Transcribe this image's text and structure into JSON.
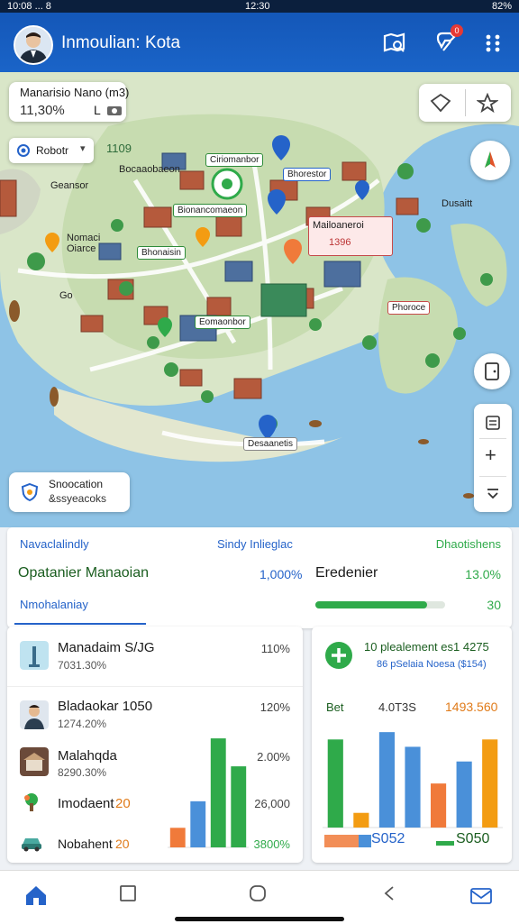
{
  "status": {
    "left": "10:08 ... 8",
    "center": "12:30",
    "right": "82%"
  },
  "app": {
    "title": "Inmoulian: Kota",
    "notification_count": "0"
  },
  "map": {
    "info_card": {
      "title": "Manarisio Nano (m3)",
      "value": "11,30%",
      "suffix": "L"
    },
    "filter": {
      "label": "Robotr"
    },
    "filter_value": "1109",
    "bottom_card": {
      "line1": "Snoocation",
      "line2": "&ssyeacoks"
    },
    "labels": [
      "Ciriomanbor",
      "Bocaaobaeon",
      "Geansor",
      "Nomaci",
      "Oiarce",
      "Go",
      "Bhorestor",
      "Bionancomaeon",
      "Bhonaisin",
      "Eomaonbor",
      "Mailoaneroi",
      "1396",
      "Dusaitt",
      "Phoroce",
      "Desaanetis",
      "Go"
    ]
  },
  "panel": {
    "header_left": "Navaclalindly",
    "header_center": "Sindy Inlieglac",
    "header_right": "Dhaotishens",
    "metric1": {
      "label": "Opatanier Manaoian",
      "value": "1,000%"
    },
    "metric2": {
      "label": "Eredenier",
      "value": "13.0%"
    },
    "progress_value": "30",
    "progress_fraction": 0.86,
    "tab": "Nmohalaniay"
  },
  "list": [
    {
      "title": "Manadaim S/JG",
      "sub": "7031.30%",
      "value": "110%"
    },
    {
      "title": "Bladaokar 1050",
      "sub": "1274.20%",
      "value": "120%"
    },
    {
      "title": "Malahqda",
      "sub": "8290.30%",
      "value": "2.00%"
    },
    {
      "title": "Imodaent",
      "num": "20",
      "value": "26,000"
    },
    {
      "title": "Nobahent",
      "num": "20",
      "value": "3800%"
    }
  ],
  "chart_card": {
    "headline": "10 plealement es1 4275",
    "sub": "86 pSelaia Noesa ($154)",
    "col1": "Bet",
    "col2": "4.0T3S",
    "col3": "1493.560",
    "foot1": "S052",
    "foot2": "S050"
  },
  "chart_data": [
    {
      "type": "bar",
      "series": [
        {
          "values": [
            14,
            33,
            78,
            58
          ]
        }
      ],
      "colors": [
        "#f07a3a",
        "#4a90d9",
        "#2faa4a",
        "#2faa4a"
      ]
    },
    {
      "type": "bar",
      "series": [
        {
          "values": [
            60,
            10,
            65,
            55,
            30,
            45,
            60
          ]
        }
      ],
      "colors": [
        "#2faa4a",
        "#f39c12",
        "#4a90d9",
        "#4a90d9",
        "#f07a3a",
        "#4a90d9",
        "#f39c12"
      ]
    }
  ],
  "colors": {
    "primary": "#1a64c8",
    "green": "#2faa4a",
    "orange": "#f07a3a",
    "blue": "#4a90d9"
  },
  "nav": [
    "home-icon",
    "square-icon",
    "circle-icon",
    "back-icon",
    "mail-icon"
  ]
}
